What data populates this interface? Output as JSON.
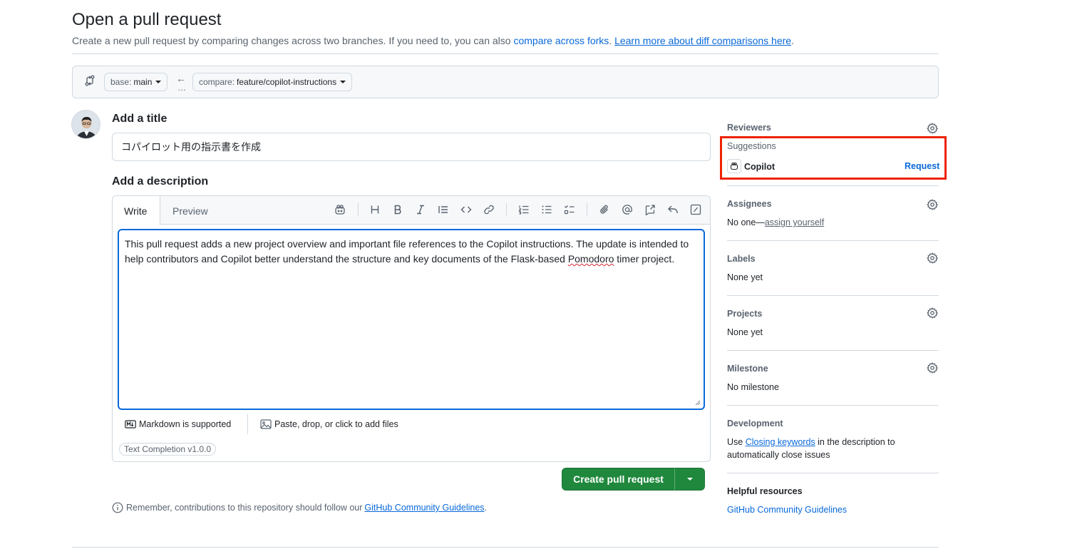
{
  "header": {
    "title": "Open a pull request",
    "subtitle_prefix": "Create a new pull request by comparing changes across two branches. If you need to, you can also ",
    "subtitle_link1": "compare across forks",
    "subtitle_mid": ". ",
    "subtitle_link2": "Learn more about diff comparisons here",
    "subtitle_suffix": "."
  },
  "range": {
    "base_label": "base:",
    "base_value": "main",
    "arrow": "←",
    "dots": "…",
    "compare_label": "compare:",
    "compare_value": "feature/copilot-instructions"
  },
  "form": {
    "title_heading": "Add a title",
    "title_value": "コパイロット用の指示書を作成",
    "description_heading": "Add a description",
    "tabs": [
      "Write",
      "Preview"
    ],
    "description_part1": "This pull request adds a new project overview and important file references to the Copilot instructions. The update is intended to help contributors and Copilot better understand the structure and key documents of the Flask-based ",
    "description_spell": "Pomodoro",
    "description_part2": " timer project.",
    "markdown_note": "Markdown is supported",
    "attach_note": "Paste, drop, or click to add files",
    "badge": "Text Completion v1.0.0",
    "submit_label": "Create pull request",
    "guidelines_prefix": "Remember, contributions to this repository should follow our",
    "guidelines_link": "GitHub Community Guidelines",
    "guidelines_suffix": "."
  },
  "toolbar_icons": [
    "copilot-icon",
    "heading-icon",
    "bold-icon",
    "italic-icon",
    "quote-icon",
    "code-icon",
    "link-icon",
    "ordered-list-icon",
    "unordered-list-icon",
    "task-list-icon",
    "attach-icon",
    "mention-icon",
    "cross-reference-icon",
    "saved-reply-icon",
    "slash-command-icon"
  ],
  "sidebar": {
    "reviewers_heading": "Reviewers",
    "suggestions_label": "Suggestions",
    "suggested_reviewer": "Copilot",
    "request_label": "Request",
    "assignees_heading": "Assignees",
    "assignees_value_prefix": "No one—",
    "assignees_link": "assign yourself",
    "labels_heading": "Labels",
    "labels_value": "None yet",
    "projects_heading": "Projects",
    "projects_value": "None yet",
    "milestone_heading": "Milestone",
    "milestone_value": "No milestone",
    "development_heading": "Development",
    "development_prefix": "Use ",
    "development_link": "Closing keywords",
    "development_suffix": " in the description to",
    "development_line2": "automatically close issues",
    "helpful_heading": "Helpful resources",
    "helpful_link": "GitHub Community Guidelines"
  },
  "colors": {
    "accent": "#0969da",
    "primary_button": "#1f883d",
    "highlight": "#ee2200",
    "border": "#d1d9e0"
  }
}
